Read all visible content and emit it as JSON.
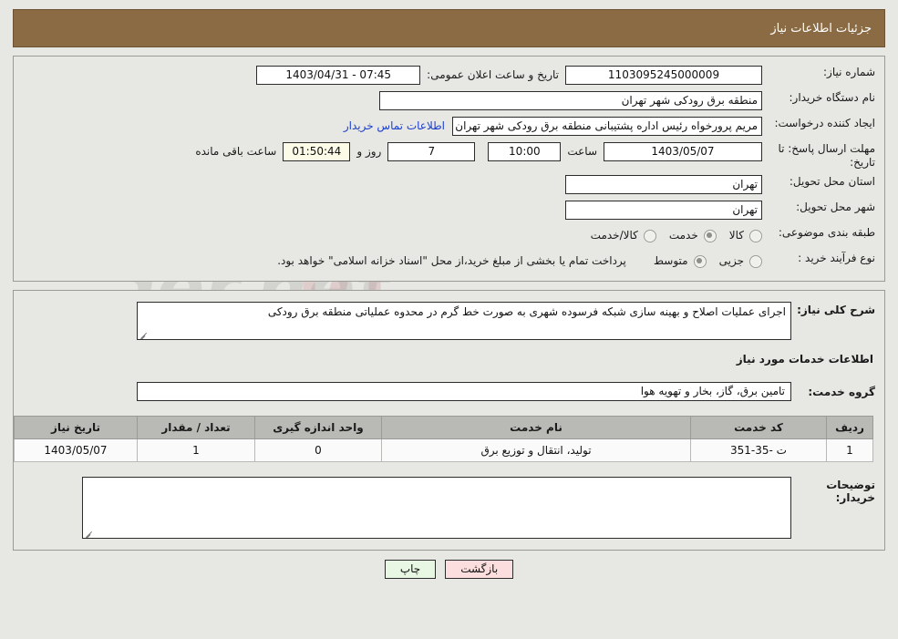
{
  "header": {
    "title": "جزئیات اطلاعات نیاز"
  },
  "colors": {
    "header_bg": "#8a6b43",
    "header_text": "#ffffff",
    "page_bg": "#e7e7e4",
    "table_header_bg": "#b9b9b5",
    "link": "#1b3fd1",
    "print_button_bg": "#e7f7e4",
    "back_button_bg": "#fbdedd",
    "countdown_bg": "#fbfbe8"
  },
  "form": {
    "need_number": {
      "label": "شماره نیاز:",
      "value": "1103095245000009"
    },
    "public_announcement": {
      "label": "تاریخ و ساعت اعلان عمومی:",
      "value": "1403/04/31 - 07:45"
    },
    "buyer_org": {
      "label": "نام دستگاه خریدار:",
      "value": "منطقه برق رودکی شهر تهران"
    },
    "request_creator": {
      "label": "ایجاد کننده درخواست:",
      "value": "مریم پرورخواه رئیس اداره پشتیبانی منطقه برق رودکی شهر تهران",
      "contact_link": "اطلاعات تماس خریدار"
    },
    "deadline": {
      "label": "مهلت ارسال پاسخ: تا تاریخ:",
      "date": "1403/05/07",
      "time_label": "ساعت",
      "time": "10:00",
      "days": "7",
      "days_label": "روز و",
      "countdown": "01:50:44",
      "remaining_label": "ساعت باقی مانده"
    },
    "delivery_province": {
      "label": "استان محل تحویل:",
      "value": "تهران"
    },
    "delivery_city": {
      "label": "شهر محل تحویل:",
      "value": "تهران"
    },
    "subject_category": {
      "label": "طبقه بندی موضوعی:",
      "options": [
        {
          "label": "کالا",
          "selected": false
        },
        {
          "label": "خدمت",
          "selected": true
        },
        {
          "label": "کالا/خدمت",
          "selected": false
        }
      ]
    },
    "purchase_process": {
      "label": "نوع فرآیند خرید :",
      "options": [
        {
          "label": "جزیی",
          "selected": false
        },
        {
          "label": "متوسط",
          "selected": true
        }
      ],
      "note": "پرداخت تمام یا بخشی از مبلغ خرید،از محل \"اسناد خزانه اسلامی\" خواهد بود."
    }
  },
  "details": {
    "general_description": {
      "label": "شرح کلی نیاز:",
      "value": "اجرای عملیات اصلاح و بهینه سازی شبکه فرسوده شهری به صورت خط گرم در محدوه عملیاتی منطقه برق رودکی"
    },
    "services_section_title": "اطلاعات خدمات مورد نیاز",
    "service_group": {
      "label": "گروه خدمت:",
      "value": "تامین برق، گاز، بخار و تهویه هوا"
    },
    "table": {
      "columns": [
        "ردیف",
        "کد خدمت",
        "نام خدمت",
        "واحد اندازه گیری",
        "تعداد / مقدار",
        "تاریخ نیاز"
      ],
      "rows": [
        {
          "radif": "1",
          "code": "ت -35-351",
          "name": "تولید، انتقال و توزیع برق",
          "unit": "0",
          "quantity": "1",
          "date": "1403/05/07"
        }
      ]
    },
    "buyer_notes": {
      "label": "توضیحات خریدار:",
      "value": ""
    }
  },
  "footer": {
    "print_button": "چاپ",
    "back_button": "بازگشت"
  }
}
